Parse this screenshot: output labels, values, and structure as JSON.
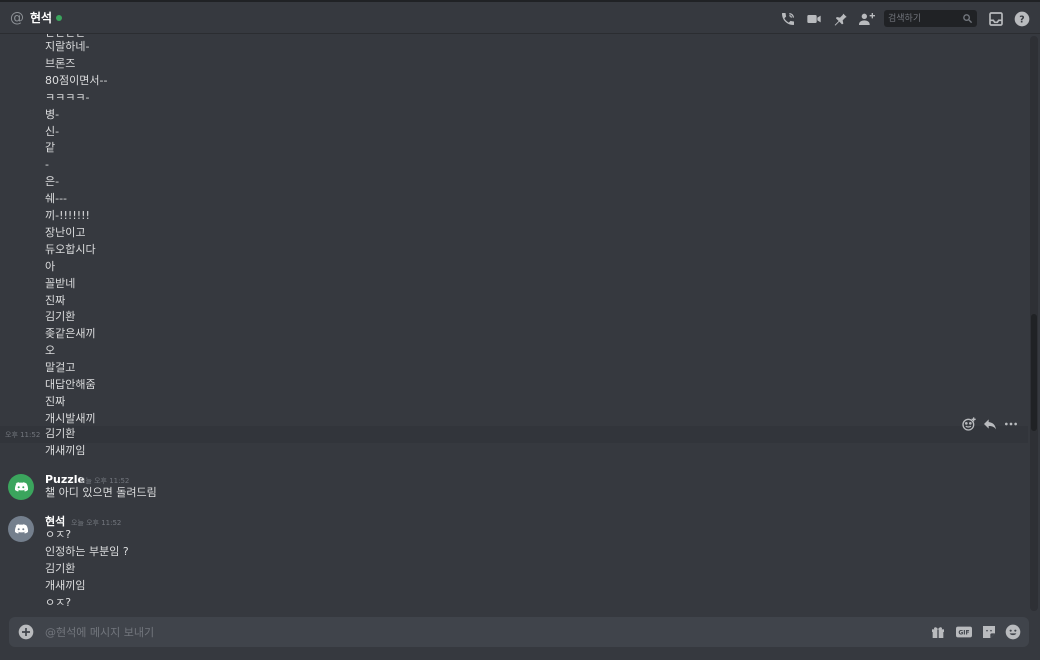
{
  "header": {
    "at_symbol": "@",
    "channel_name": "현석",
    "status_color": "#3ba55d",
    "icons": [
      "phone-call-icon",
      "video-camera-icon",
      "pin-icon",
      "add-friend-icon",
      "inbox-icon",
      "help-icon"
    ],
    "search_placeholder": "검색하기"
  },
  "messages": {
    "continued_lines": [
      "지랄하네-",
      "브론즈",
      "80점이면서--",
      "ㅋㅋㅋㅋ-",
      "병-",
      "신-",
      "같",
      "-",
      "은-",
      "쉐---",
      "끼-!!!!!!!",
      "장난이고",
      "듀오합시다",
      "아",
      "꼴받네",
      "진짜",
      "김기환",
      "좆같은새끼",
      "오",
      "말걸고",
      "대답안해줌",
      "진짜",
      "개시발새끼"
    ],
    "hovered": {
      "side_time": "오후 11:52",
      "text": "김기환"
    },
    "after_hover": [
      "개새끼임"
    ],
    "groups": [
      {
        "author": "Puzzle",
        "time": "오늘 오후 11:52",
        "avatar_color": "#3ba55d",
        "lines": [
          "챌 아디 있으면 돌려드림"
        ]
      },
      {
        "author": "현석",
        "time": "오늘 오후 11:52",
        "avatar_color": "#747f8d",
        "lines": [
          "ㅇㅈ?",
          "인정하는 부분임 ?",
          "김기환",
          "개새끼임",
          "ㅇㅈ?"
        ]
      }
    ]
  },
  "hover_actions": [
    "add-reaction-icon",
    "reply-icon",
    "more-icon"
  ],
  "composer": {
    "placeholder": "@현석에 메시지 보내기",
    "icons": [
      "add-attachment-icon",
      "gift-icon",
      "gif-icon",
      "sticker-icon",
      "emoji-icon"
    ],
    "gif_label": "GIF"
  },
  "colors": {
    "background": "#36393f",
    "composer": "#40444b",
    "text": "#dcddde",
    "muted": "#72767d"
  }
}
